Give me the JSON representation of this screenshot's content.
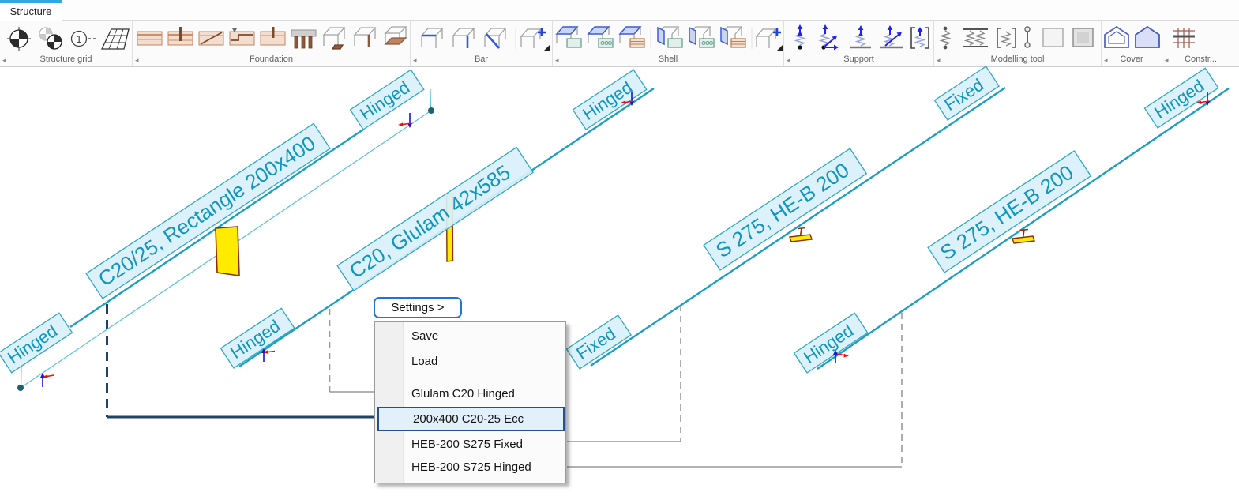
{
  "tab": {
    "label": "Structure"
  },
  "ribbon": {
    "groups": [
      {
        "label": "Structure grid",
        "icons": [
          "axes",
          "double-axes",
          "grid-line-numbering",
          "perspective-grid"
        ]
      },
      {
        "label": "Foundation",
        "icons": [
          "strip-foundation",
          "wall-foundation",
          "sloped-foundation",
          "stepped-foundation",
          "pad-foundation",
          "pile-cap",
          "3d-pad",
          "3d-wall-foundation",
          "3d-slab-foundation"
        ]
      },
      {
        "label": "Bar",
        "icons": [
          "beam",
          "column",
          "truss-member",
          "add-bar"
        ]
      },
      {
        "label": "Shell",
        "icons": [
          "slab-plain",
          "slab-hollow-core",
          "slab-timber",
          "wall-plain",
          "wall-hollow-core",
          "wall-timber",
          "add-shell"
        ]
      },
      {
        "label": "Support",
        "icons": [
          "point-support",
          "point-support-directed",
          "line-support",
          "line-support-directed",
          "surface-support"
        ]
      },
      {
        "label": "Modelling tool",
        "icons": [
          "point-connection",
          "line-connection",
          "surface-connection",
          "fictitious-bar",
          "fictitious-shell",
          "diaphragm"
        ]
      },
      {
        "label": "Cover",
        "icons": [
          "cover-outline",
          "cover-filled"
        ]
      },
      {
        "label": "Constr...",
        "icons": [
          "construction-grid"
        ]
      }
    ]
  },
  "canvas": {
    "beams": [
      {
        "section_label": "C20/25, Rectangle 200x400",
        "start_support": "Hinged",
        "end_support": "Hinged",
        "eccentric": true
      },
      {
        "section_label": "C20, Glulam 42x585",
        "start_support": "Hinged",
        "end_support": "Hinged"
      },
      {
        "section_label": "S 275, HE-B 200",
        "start_support": "Fixed",
        "end_support": "Fixed"
      },
      {
        "section_label": "S 275, HE-B 200",
        "start_support": "Hinged",
        "end_support": "Hinged"
      }
    ]
  },
  "settings_menu": {
    "button_label": "Settings >",
    "items": [
      {
        "label": "Save"
      },
      {
        "label": "Load"
      },
      {
        "label": "Glulam C20 Hinged"
      },
      {
        "label": "200x400 C20-25 Ecc",
        "highlighted": true
      },
      {
        "label": "HEB-200 S275 Fixed"
      },
      {
        "label": "HEB-200 S725 Hinged"
      }
    ]
  },
  "colors": {
    "tab_accent": "#2fa7e0",
    "beam_line": "#1d9fc0",
    "beam_ecc_line": "#5fc3dc",
    "label_fill": "#d9f0f8",
    "label_border": "#31a8c4",
    "label_text": "#1295be",
    "node_dot": "#1a6372",
    "section_fill": "#ffeb00",
    "section_outline": "#8c2d04",
    "axis_red": "#e8120c",
    "axis_blue": "#1414d2",
    "selected_leader": "#1f4266",
    "leader_gray": "#999999",
    "menu_highlight_fill": "#e2f0fb",
    "menu_highlight_border": "#24508c",
    "settings_border": "#1e77cf"
  }
}
